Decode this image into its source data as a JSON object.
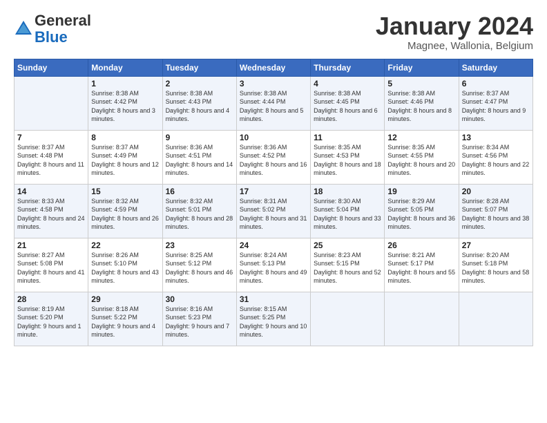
{
  "header": {
    "logo_general": "General",
    "logo_blue": "Blue",
    "month_title": "January 2024",
    "location": "Magnee, Wallonia, Belgium"
  },
  "days_of_week": [
    "Sunday",
    "Monday",
    "Tuesday",
    "Wednesday",
    "Thursday",
    "Friday",
    "Saturday"
  ],
  "weeks": [
    [
      {
        "day": "",
        "sunrise": "",
        "sunset": "",
        "daylight": ""
      },
      {
        "day": "1",
        "sunrise": "Sunrise: 8:38 AM",
        "sunset": "Sunset: 4:42 PM",
        "daylight": "Daylight: 8 hours and 3 minutes."
      },
      {
        "day": "2",
        "sunrise": "Sunrise: 8:38 AM",
        "sunset": "Sunset: 4:43 PM",
        "daylight": "Daylight: 8 hours and 4 minutes."
      },
      {
        "day": "3",
        "sunrise": "Sunrise: 8:38 AM",
        "sunset": "Sunset: 4:44 PM",
        "daylight": "Daylight: 8 hours and 5 minutes."
      },
      {
        "day": "4",
        "sunrise": "Sunrise: 8:38 AM",
        "sunset": "Sunset: 4:45 PM",
        "daylight": "Daylight: 8 hours and 6 minutes."
      },
      {
        "day": "5",
        "sunrise": "Sunrise: 8:38 AM",
        "sunset": "Sunset: 4:46 PM",
        "daylight": "Daylight: 8 hours and 8 minutes."
      },
      {
        "day": "6",
        "sunrise": "Sunrise: 8:37 AM",
        "sunset": "Sunset: 4:47 PM",
        "daylight": "Daylight: 8 hours and 9 minutes."
      }
    ],
    [
      {
        "day": "7",
        "sunrise": "Sunrise: 8:37 AM",
        "sunset": "Sunset: 4:48 PM",
        "daylight": "Daylight: 8 hours and 11 minutes."
      },
      {
        "day": "8",
        "sunrise": "Sunrise: 8:37 AM",
        "sunset": "Sunset: 4:49 PM",
        "daylight": "Daylight: 8 hours and 12 minutes."
      },
      {
        "day": "9",
        "sunrise": "Sunrise: 8:36 AM",
        "sunset": "Sunset: 4:51 PM",
        "daylight": "Daylight: 8 hours and 14 minutes."
      },
      {
        "day": "10",
        "sunrise": "Sunrise: 8:36 AM",
        "sunset": "Sunset: 4:52 PM",
        "daylight": "Daylight: 8 hours and 16 minutes."
      },
      {
        "day": "11",
        "sunrise": "Sunrise: 8:35 AM",
        "sunset": "Sunset: 4:53 PM",
        "daylight": "Daylight: 8 hours and 18 minutes."
      },
      {
        "day": "12",
        "sunrise": "Sunrise: 8:35 AM",
        "sunset": "Sunset: 4:55 PM",
        "daylight": "Daylight: 8 hours and 20 minutes."
      },
      {
        "day": "13",
        "sunrise": "Sunrise: 8:34 AM",
        "sunset": "Sunset: 4:56 PM",
        "daylight": "Daylight: 8 hours and 22 minutes."
      }
    ],
    [
      {
        "day": "14",
        "sunrise": "Sunrise: 8:33 AM",
        "sunset": "Sunset: 4:58 PM",
        "daylight": "Daylight: 8 hours and 24 minutes."
      },
      {
        "day": "15",
        "sunrise": "Sunrise: 8:32 AM",
        "sunset": "Sunset: 4:59 PM",
        "daylight": "Daylight: 8 hours and 26 minutes."
      },
      {
        "day": "16",
        "sunrise": "Sunrise: 8:32 AM",
        "sunset": "Sunset: 5:01 PM",
        "daylight": "Daylight: 8 hours and 28 minutes."
      },
      {
        "day": "17",
        "sunrise": "Sunrise: 8:31 AM",
        "sunset": "Sunset: 5:02 PM",
        "daylight": "Daylight: 8 hours and 31 minutes."
      },
      {
        "day": "18",
        "sunrise": "Sunrise: 8:30 AM",
        "sunset": "Sunset: 5:04 PM",
        "daylight": "Daylight: 8 hours and 33 minutes."
      },
      {
        "day": "19",
        "sunrise": "Sunrise: 8:29 AM",
        "sunset": "Sunset: 5:05 PM",
        "daylight": "Daylight: 8 hours and 36 minutes."
      },
      {
        "day": "20",
        "sunrise": "Sunrise: 8:28 AM",
        "sunset": "Sunset: 5:07 PM",
        "daylight": "Daylight: 8 hours and 38 minutes."
      }
    ],
    [
      {
        "day": "21",
        "sunrise": "Sunrise: 8:27 AM",
        "sunset": "Sunset: 5:08 PM",
        "daylight": "Daylight: 8 hours and 41 minutes."
      },
      {
        "day": "22",
        "sunrise": "Sunrise: 8:26 AM",
        "sunset": "Sunset: 5:10 PM",
        "daylight": "Daylight: 8 hours and 43 minutes."
      },
      {
        "day": "23",
        "sunrise": "Sunrise: 8:25 AM",
        "sunset": "Sunset: 5:12 PM",
        "daylight": "Daylight: 8 hours and 46 minutes."
      },
      {
        "day": "24",
        "sunrise": "Sunrise: 8:24 AM",
        "sunset": "Sunset: 5:13 PM",
        "daylight": "Daylight: 8 hours and 49 minutes."
      },
      {
        "day": "25",
        "sunrise": "Sunrise: 8:23 AM",
        "sunset": "Sunset: 5:15 PM",
        "daylight": "Daylight: 8 hours and 52 minutes."
      },
      {
        "day": "26",
        "sunrise": "Sunrise: 8:21 AM",
        "sunset": "Sunset: 5:17 PM",
        "daylight": "Daylight: 8 hours and 55 minutes."
      },
      {
        "day": "27",
        "sunrise": "Sunrise: 8:20 AM",
        "sunset": "Sunset: 5:18 PM",
        "daylight": "Daylight: 8 hours and 58 minutes."
      }
    ],
    [
      {
        "day": "28",
        "sunrise": "Sunrise: 8:19 AM",
        "sunset": "Sunset: 5:20 PM",
        "daylight": "Daylight: 9 hours and 1 minute."
      },
      {
        "day": "29",
        "sunrise": "Sunrise: 8:18 AM",
        "sunset": "Sunset: 5:22 PM",
        "daylight": "Daylight: 9 hours and 4 minutes."
      },
      {
        "day": "30",
        "sunrise": "Sunrise: 8:16 AM",
        "sunset": "Sunset: 5:23 PM",
        "daylight": "Daylight: 9 hours and 7 minutes."
      },
      {
        "day": "31",
        "sunrise": "Sunrise: 8:15 AM",
        "sunset": "Sunset: 5:25 PM",
        "daylight": "Daylight: 9 hours and 10 minutes."
      },
      {
        "day": "",
        "sunrise": "",
        "sunset": "",
        "daylight": ""
      },
      {
        "day": "",
        "sunrise": "",
        "sunset": "",
        "daylight": ""
      },
      {
        "day": "",
        "sunrise": "",
        "sunset": "",
        "daylight": ""
      }
    ]
  ]
}
